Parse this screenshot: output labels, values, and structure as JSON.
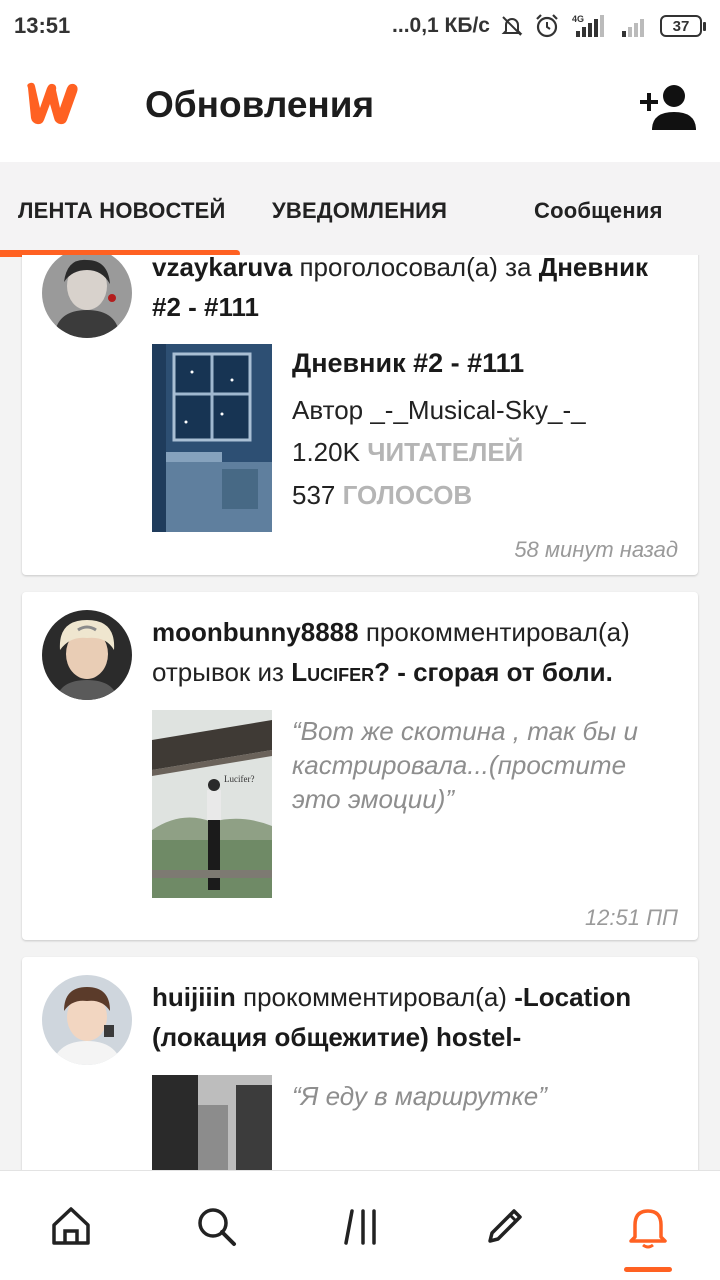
{
  "status_bar": {
    "time": "13:51",
    "network_speed": "...0,1 КБ/с",
    "signal_label": "4G",
    "battery": "37"
  },
  "header": {
    "title": "Обновления",
    "brand_color": "#ff6122"
  },
  "tabs": [
    {
      "label": "ЛЕНТА НОВОСТЕЙ",
      "active": true
    },
    {
      "label": "УВЕДОМЛЕНИЯ",
      "active": false
    },
    {
      "label": "Сообщения",
      "active": false
    }
  ],
  "feed": [
    {
      "user": "vzaykaruva",
      "action": " проголосовал(а) за ",
      "target": "Дневник #2 - #111",
      "book_title": "Дневник #2 - #111",
      "author_line": "Автор _-_Musical-Sky_-_",
      "readers_value": "1.20K",
      "readers_label": "ЧИТАТЕЛЕЙ",
      "votes_value": "537",
      "votes_label": "ГОЛОСОВ",
      "time": "58 минут назад"
    },
    {
      "user": "moonbunny8888",
      "action": " прокомментировал(а) отрывок из ",
      "target_story": "Lucifer?",
      "target_part": " - сгорая от боли.",
      "quote": "“Вот же скотина , так бы и кастрировала...(простите это эмоции)”",
      "time": "12:51 ПП"
    },
    {
      "user": "huijiiin",
      "action": " прокомментировал(а) ",
      "target": "-Location (локация общежитие) hostel-",
      "quote": "“Я еду в маршрутке”"
    }
  ],
  "bottom_nav": [
    {
      "icon": "home-icon",
      "active": false
    },
    {
      "icon": "search-icon",
      "active": false
    },
    {
      "icon": "library-icon",
      "active": false
    },
    {
      "icon": "pencil-icon",
      "active": false
    },
    {
      "icon": "bell-icon",
      "active": true
    }
  ]
}
